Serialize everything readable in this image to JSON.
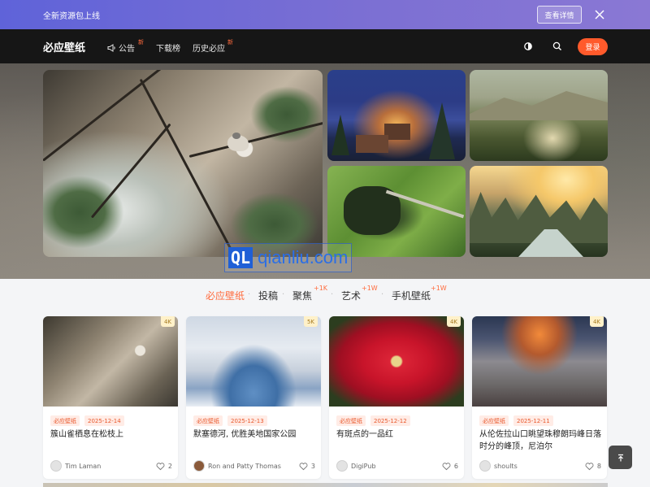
{
  "announcement": {
    "text": "全新资源包上线",
    "button": "查看详情"
  },
  "nav": {
    "logo": "必应壁纸",
    "items": [
      {
        "label": "公告",
        "badge": "新"
      },
      {
        "label": "下载榜",
        "badge": ""
      },
      {
        "label": "历史必应",
        "badge": "新"
      }
    ],
    "login": "登录"
  },
  "watermark": {
    "box": "QL",
    "text": "qianliu.com"
  },
  "categories": [
    {
      "label": "必应壁纸",
      "badge": ""
    },
    {
      "label": "投稿",
      "badge": ""
    },
    {
      "label": "聚焦",
      "badge": "+1K"
    },
    {
      "label": "艺术",
      "badge": "+1W"
    },
    {
      "label": "手机壁纸",
      "badge": "+1W"
    }
  ],
  "cards": [
    {
      "resolution": "4K",
      "tag": "必应壁纸",
      "date": "2025-12-14",
      "title": "簇山雀栖息在松枝上",
      "author": "Tim Laman",
      "likes": "2"
    },
    {
      "resolution": "5K",
      "tag": "必应壁纸",
      "date": "2025-12-13",
      "title": "默塞德河, 优胜美地国家公园",
      "author": "Ron and Patty Thomas",
      "likes": "3"
    },
    {
      "resolution": "4K",
      "tag": "必应壁纸",
      "date": "2025-12-12",
      "title": "有斑点的一品红",
      "author": "DigiPub",
      "likes": "6"
    },
    {
      "resolution": "4K",
      "tag": "必应壁纸",
      "date": "2025-12-11",
      "title": "从伦佐拉山口眺望珠穆朗玛峰日落时分的峰顶，尼泊尔",
      "author": "shoults",
      "likes": "8"
    }
  ],
  "colors": {
    "accent": "#ff5a2b",
    "nav_bg": "#161616",
    "announce_start": "#5f63d9",
    "announce_end": "#8a78d4"
  }
}
